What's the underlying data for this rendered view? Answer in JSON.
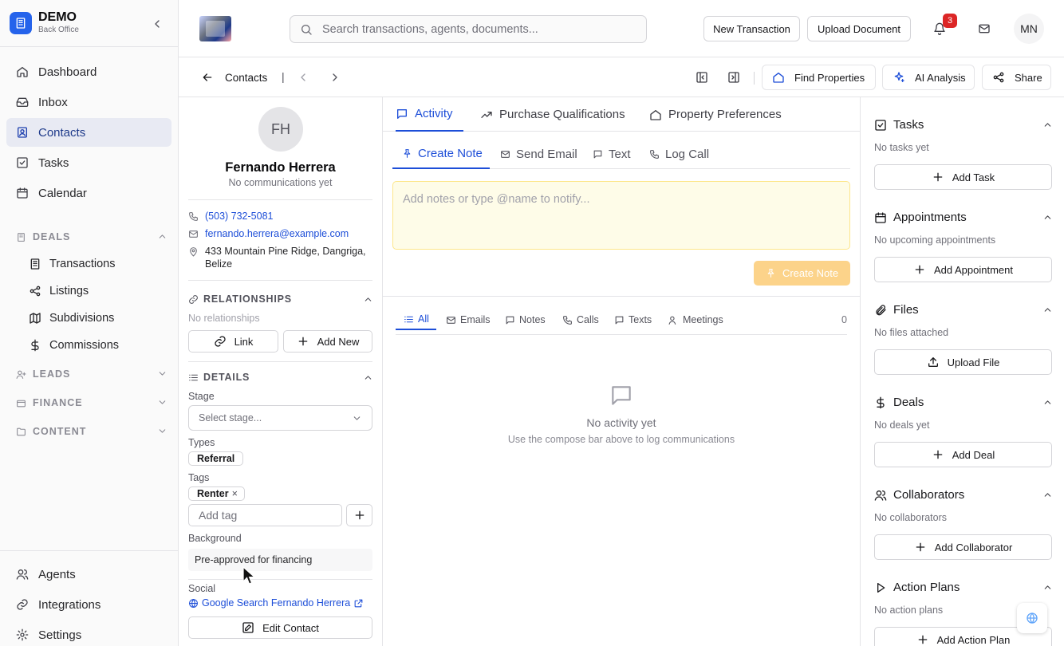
{
  "brand": {
    "name": "DEMO",
    "subtitle": "Back Office"
  },
  "sidebar": {
    "main": [
      {
        "label": "Dashboard",
        "icon": "home-icon"
      },
      {
        "label": "Inbox",
        "icon": "inbox-icon"
      },
      {
        "label": "Contacts",
        "icon": "contacts-icon",
        "active": true
      },
      {
        "label": "Tasks",
        "icon": "check-square-icon"
      },
      {
        "label": "Calendar",
        "icon": "calendar-icon"
      }
    ],
    "deals_section": "DEALS",
    "deals_items": [
      "Transactions",
      "Listings",
      "Subdivisions",
      "Commissions"
    ],
    "leads_section": "LEADS",
    "finance_section": "FINANCE",
    "content_section": "CONTENT",
    "bottom": [
      "Agents",
      "Integrations",
      "Settings"
    ]
  },
  "header": {
    "search_placeholder": "Search transactions, agents, documents...",
    "new_transaction": "New Transaction",
    "upload_document": "Upload Document",
    "notification_count": "3",
    "user_initials": "MN"
  },
  "subbar": {
    "back_label": "Contacts",
    "separator": "|",
    "find_properties": "Find Properties",
    "ai_analysis": "AI Analysis",
    "share": "Share"
  },
  "contact": {
    "initials": "FH",
    "name": "Fernando Herrera",
    "comm_status": "No communications yet",
    "phone": "(503) 732-5081",
    "email": "fernando.herrera@example.com",
    "address": "433 Mountain Pine Ridge, Dangriga, Belize",
    "relationships_title": "RELATIONSHIPS",
    "relationships_empty": "No relationships",
    "link_label": "Link",
    "add_new_label": "Add New",
    "details_title": "DETAILS",
    "stage_label": "Stage",
    "stage_placeholder": "Select stage...",
    "types_label": "Types",
    "type_value": "Referral",
    "tags_label": "Tags",
    "tag_value": "Renter",
    "tag_remove": "×",
    "add_tag_placeholder": "Add tag",
    "background_label": "Background",
    "background_value": "Pre-approved for financing",
    "social_label": "Social",
    "social_link": "Google Search Fernando Herrera",
    "edit_contact": "Edit Contact"
  },
  "center": {
    "tabs": [
      "Activity",
      "Purchase Qualifications",
      "Property Preferences"
    ],
    "compose_tabs": [
      "Create Note",
      "Send Email",
      "Text",
      "Log Call"
    ],
    "note_placeholder": "Add notes or type @name to notify...",
    "create_note_button": "Create Note",
    "filter_tabs": [
      "All",
      "Emails",
      "Notes",
      "Calls",
      "Texts",
      "Meetings"
    ],
    "filter_count": "0",
    "empty_title": "No activity yet",
    "empty_subtitle": "Use the compose bar above to log communications"
  },
  "right": {
    "tasks_title": "Tasks",
    "tasks_empty": "No tasks yet",
    "tasks_btn": "Add Task",
    "appointments_title": "Appointments",
    "appointments_empty": "No upcoming appointments",
    "appointments_btn": "Add Appointment",
    "files_title": "Files",
    "files_empty": "No files attached",
    "files_btn": "Upload File",
    "deals_title": "Deals",
    "deals_empty": "No deals yet",
    "deals_btn": "Add Deal",
    "collaborators_title": "Collaborators",
    "collaborators_empty": "No collaborators",
    "collaborators_btn": "Add Collaborator",
    "action_plans_title": "Action Plans",
    "action_plans_empty": "No action plans",
    "action_plans_btn": "Add Action Plan"
  },
  "colors": {
    "accent": "#1d4ed8",
    "brand": "#2563eb",
    "note_bg": "#fefce8",
    "create_note": "#fcd38a",
    "badge": "#dc2626"
  }
}
